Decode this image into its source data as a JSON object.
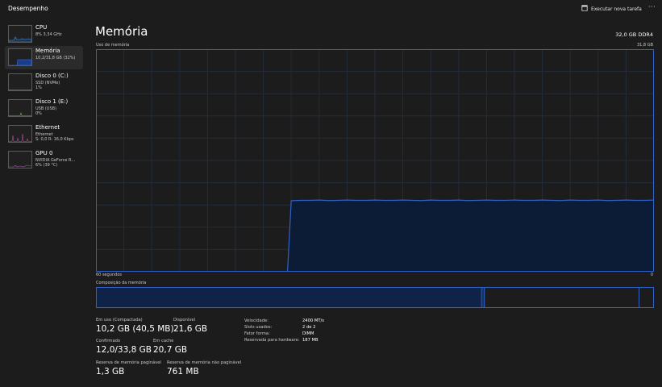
{
  "window": {
    "title": "Desempenho"
  },
  "toolbar": {
    "run_task_label": "Executar nova tarefa",
    "more_label": "···"
  },
  "sidebar": {
    "items": [
      {
        "name": "CPU",
        "line1": "8%  3,34 GHz",
        "line2": ""
      },
      {
        "name": "Memória",
        "line1": "10,2/31,8 GB (32%)",
        "line2": ""
      },
      {
        "name": "Disco 0 (C:)",
        "line1": "SSD (NVMe)",
        "line2": "1%"
      },
      {
        "name": "Disco 1 (E:)",
        "line1": "USB (USB)",
        "line2": "0%"
      },
      {
        "name": "Ethernet",
        "line1": "Ethernet",
        "line2": "S: 0,0  R: 16,0 Kbps"
      },
      {
        "name": "GPU 0",
        "line1": "NVIDIA GeForce R...",
        "line2": "6%  (39 °C)"
      }
    ]
  },
  "main": {
    "title": "Memória",
    "spec": "32,0 GB DDR4",
    "graph_label": "Uso de memória",
    "graph_max": "31,8 GB",
    "axis_left": "60 segundos",
    "axis_right": "0",
    "composition_label": "Composição da memória"
  },
  "stats": {
    "in_use_label": "Em uso (Compactada)",
    "in_use_value": "10,2 GB (40,5 MB)",
    "available_label": "Disponível",
    "available_value": "21,6 GB",
    "committed_label": "Confirmado",
    "committed_value": "12,0/33,8 GB",
    "cached_label": "Em cache",
    "cached_value": "20,7 GB",
    "paged_label": "Reserva de memória paginável",
    "paged_value": "1,3 GB",
    "nonpaged_label": "Reserva de memória não paginável",
    "nonpaged_value": "761 MB"
  },
  "details": {
    "speed_label": "Velocidade:",
    "speed_value": "2400 MT/s",
    "slots_label": "Slots usados:",
    "slots_value": "2 de 2",
    "form_label": "Fator forma:",
    "form_value": "DIMM",
    "reserved_label": "Reservada para hardware:",
    "reserved_value": "187 MB"
  },
  "colors": {
    "accent": "#2f62c9",
    "fill": "#0c1c38",
    "grid": "#232c3a",
    "background": "#1c1c1c",
    "thumb_cpu": "#4a90d9",
    "thumb_mem": "#3a6fd1",
    "thumb_disk": "#6ab04c",
    "thumb_eth": "#b0509a",
    "thumb_gpu": "#a050b0"
  },
  "chart_data": {
    "type": "area",
    "title": "Uso de memória",
    "x_range": [
      60,
      0
    ],
    "xlabel": "",
    "ylabel": "",
    "ylim": [
      0,
      31.8
    ],
    "unit": "GB",
    "series": [
      {
        "values": [
          0,
          0,
          0,
          0,
          0,
          0,
          0,
          0,
          0,
          0,
          0,
          0,
          0,
          0,
          0,
          0,
          0,
          0,
          0,
          0,
          0,
          10.1,
          10.2,
          10.2,
          10.2,
          10.2,
          10.2,
          10.2,
          10.2,
          10.2,
          10.2,
          10.2,
          10.2,
          10.2,
          10.2,
          10.2,
          10.2,
          10.2,
          10.2,
          10.2,
          10.2,
          10.2,
          10.2,
          10.2,
          10.2,
          10.2,
          10.2,
          10.2,
          10.2,
          10.2,
          10.2,
          10.2,
          10.2,
          10.2,
          10.2,
          10.2,
          10.2,
          10.2,
          10.2,
          10.2,
          10.2
        ]
      }
    ],
    "grid": true
  },
  "composition": {
    "in_use": 10.2,
    "modified": 0.1,
    "standby": 20.7,
    "free": 0.8,
    "total": 31.8
  }
}
